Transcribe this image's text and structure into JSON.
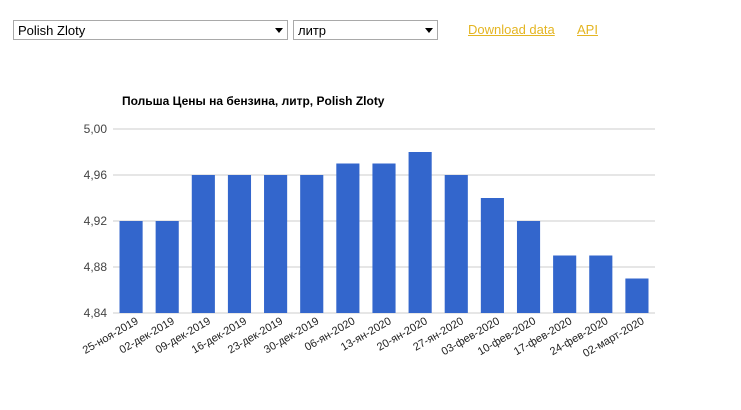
{
  "controls": {
    "currency_select": "Polish Zloty",
    "unit_select": "литр",
    "download_link": "Download data",
    "api_link": "API"
  },
  "colors": {
    "bar": "#3366cc",
    "grid": "#cccccc",
    "link": "#e4b522"
  },
  "chart_data": {
    "type": "bar",
    "title": "Польша Цены на бензина, литр, Polish Zloty",
    "categories": [
      "25-ноя-2019",
      "02-дек-2019",
      "09-дек-2019",
      "16-дек-2019",
      "23-дек-2019",
      "30-дек-2019",
      "06-янв-2020",
      "13-янв-2020",
      "20-янв-2020",
      "27-янв-2020",
      "03-фев-2020",
      "10-фев-2020",
      "17-фев-2020",
      "24-фев-2020",
      "02-март-2020"
    ],
    "category_labels": [
      "25-ноя-2019",
      "02-дек-2019",
      "09-дек-2019",
      "16-дек-2019",
      "23-дек-2019",
      "30-дек-2019",
      "06-ян-2020",
      "13-ян-2020",
      "20-ян-2020",
      "27-ян-2020",
      "03-фев-2020",
      "10-фев-2020",
      "17-фев-2020",
      "24-фев-2020",
      "02-март-2020"
    ],
    "values": [
      4.92,
      4.92,
      4.96,
      4.96,
      4.96,
      4.96,
      4.97,
      4.97,
      4.98,
      4.96,
      4.94,
      4.92,
      4.89,
      4.89,
      4.87
    ],
    "ylim": [
      4.84,
      5.0
    ],
    "yticks": [
      "4,84",
      "4,88",
      "4,92",
      "4,96",
      "5,00"
    ],
    "grid": true,
    "xlabel": "",
    "ylabel": ""
  }
}
